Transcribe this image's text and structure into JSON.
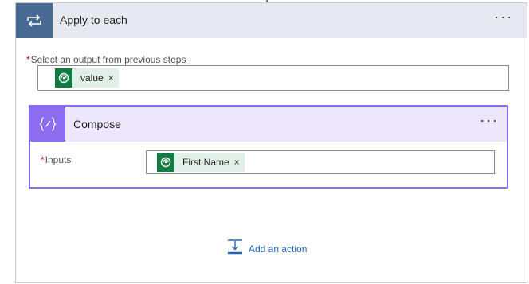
{
  "loop": {
    "title": "Apply to each",
    "more_label": "···",
    "select_label": "Select an output from previous steps",
    "required_mark": "*",
    "token": {
      "label": "value",
      "close": "×"
    }
  },
  "compose": {
    "title": "Compose",
    "more_label": "···",
    "inputs_label": "Inputs",
    "required_mark": "*",
    "token": {
      "label": "First Name",
      "close": "×"
    }
  },
  "add_action": {
    "label": "Add an action"
  },
  "colors": {
    "loop_accent": "#486991",
    "compose_accent": "#8c6cf0",
    "token_icon": "#107c41",
    "link": "#2266b8"
  },
  "icons": {
    "loop": "loop-arrows-icon",
    "compose": "curly-braces-icon",
    "token": "dataverse-icon",
    "add": "add-action-icon"
  }
}
